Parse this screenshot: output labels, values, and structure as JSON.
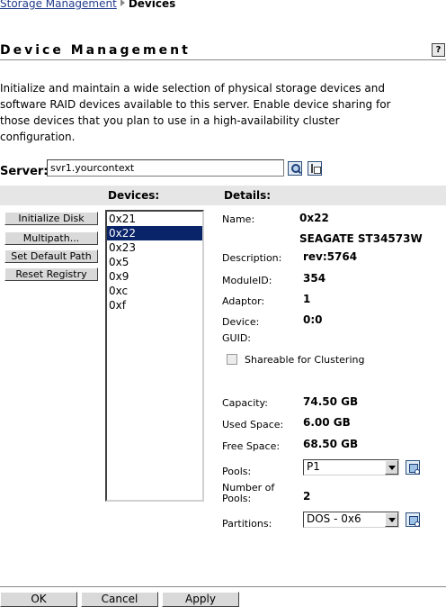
{
  "breadcrumb": {
    "link": "Storage Management",
    "current": "Devices"
  },
  "page": {
    "title": "Device Management",
    "help_label": "?",
    "description": "Initialize and maintain a wide selection of physical storage devices and software RAID devices available to this server. Enable device sharing for those devices that you plan to use in a high-availability cluster configuration."
  },
  "server": {
    "label": "Server:",
    "value": "svr1.yourcontext",
    "search_icon": "search-icon",
    "browse_icon": "tree-browse-icon"
  },
  "columns": {
    "devices": "Devices:",
    "details": "Details:"
  },
  "actions": {
    "initialize": "Initialize Disk",
    "multipath": "Multipath...",
    "set_default_path": "Set Default Path",
    "reset_registry": "Reset Registry"
  },
  "devices": {
    "selected": "0x22",
    "items": [
      "0x21",
      "0x22",
      "0x23",
      "0x5",
      "0x9",
      "0xc",
      "0xf"
    ]
  },
  "details": {
    "name_label": "Name:",
    "name": "0x22",
    "model": "SEAGATE ST34573W",
    "description_label": "Description:",
    "description": "rev:5764",
    "module_label": "ModuleID:",
    "module": "354",
    "adaptor_label": "Adaptor:",
    "adaptor": "1",
    "device_label": "Device:",
    "guid_label": "GUID:",
    "device": "0:0",
    "shareable_label": "Shareable for Clustering",
    "shareable_checked": false,
    "capacity_label": "Capacity:",
    "capacity": "74.50 GB",
    "used_label": "Used Space:",
    "used": "6.00 GB",
    "free_label": "Free Space:",
    "free": "68.50 GB",
    "pools_label": "Pools:",
    "pools_selected": "P1",
    "num_pools_label_1": "Number of",
    "num_pools_label_2": "Pools:",
    "num_pools": "2",
    "partitions_label": "Partitions:",
    "partitions_selected": "DOS - 0x6"
  },
  "footer": {
    "ok": "OK",
    "cancel": "Cancel",
    "apply": "Apply"
  },
  "colors": {
    "selection": "#0a246a",
    "link": "#223d8c",
    "header_band": "#e6e6e6"
  }
}
